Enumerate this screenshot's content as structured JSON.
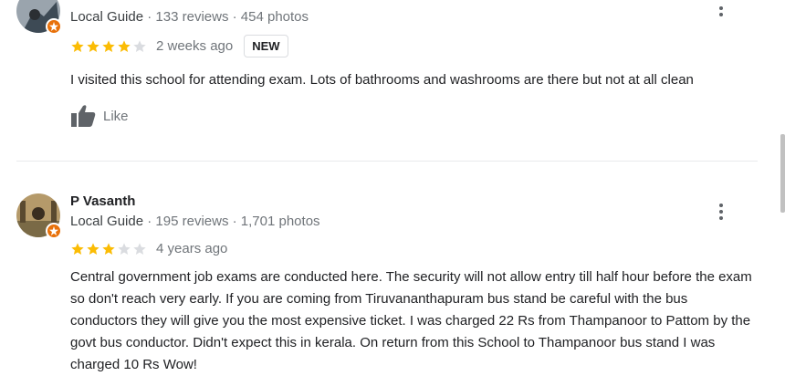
{
  "reviews": [
    {
      "reviewer_name": "",
      "local_guide_label": "Local Guide",
      "reviews_count": "133 reviews",
      "photos_count": "454 photos",
      "rating": 4,
      "date": "2 weeks ago",
      "new_label": "NEW",
      "text": "I visited this school for attending exam.  Lots of bathrooms and washrooms are there but not at all clean",
      "like_label": "Like"
    },
    {
      "reviewer_name": "P Vasanth",
      "local_guide_label": "Local Guide",
      "reviews_count": "195 reviews",
      "photos_count": "1,701 photos",
      "rating": 3,
      "date": "4 years ago",
      "text": "Central government job exams are conducted here. The security will not allow entry till half hour before the exam so don't reach very early. If you are coming from Tiruvananthapuram bus stand be careful with the bus conductors they will give you the most expensive ticket. I was charged 22 Rs from Thampanoor to Pattom by the govt bus conductor. Didn't expect this in kerala. On return from this School to Thampanoor bus stand I was charged 10 Rs Wow!"
    }
  ],
  "separator": " · ",
  "colors": {
    "star_filled": "#fbbc04",
    "star_empty": "#dadce0",
    "badge": "#e8710a"
  }
}
